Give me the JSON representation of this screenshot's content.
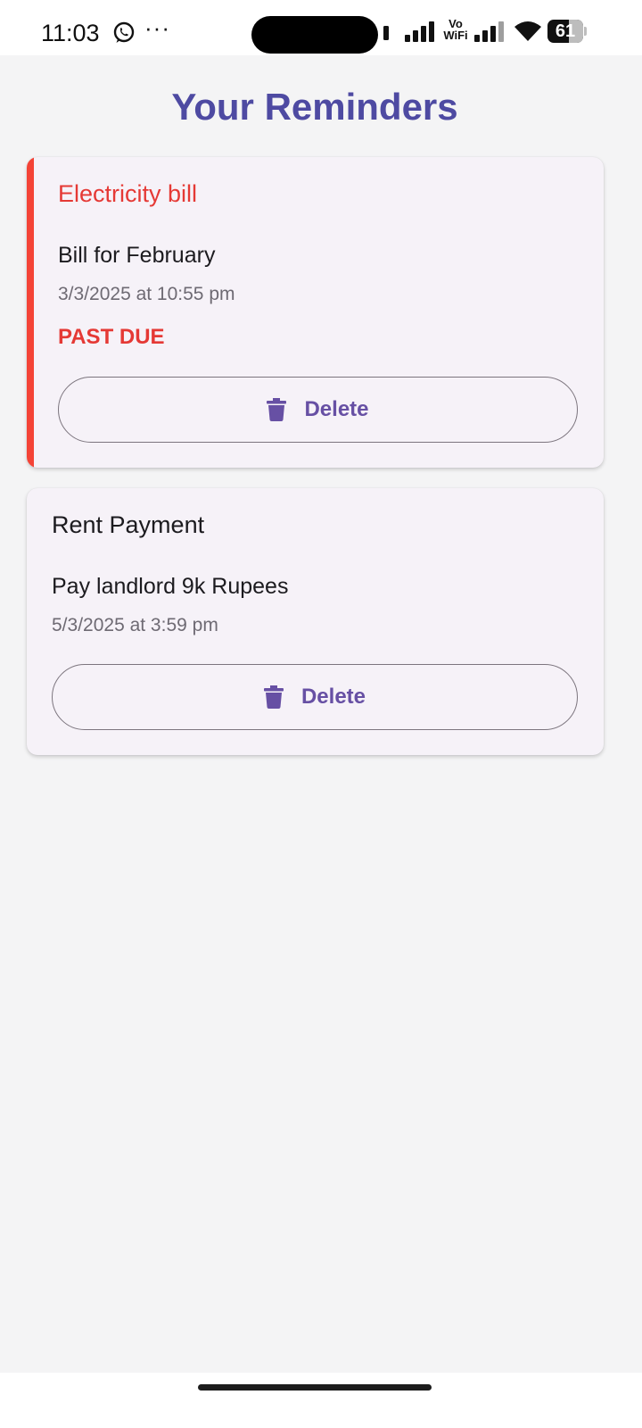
{
  "status_bar": {
    "time": "11:03",
    "vowifi_top": "Vo",
    "vowifi_bottom": "WiFi",
    "battery": "61",
    "battery_level_percent": 61,
    "more": "···"
  },
  "page": {
    "title": "Your Reminders"
  },
  "reminders": [
    {
      "title": "Electricity bill",
      "description": "Bill for February",
      "datetime": "3/3/2025 at 10:55 pm",
      "status": "PAST DUE",
      "delete_label": "Delete"
    },
    {
      "title": "Rent Payment",
      "description": "Pay landlord 9k Rupees",
      "datetime": "5/3/2025 at 3:59 pm",
      "delete_label": "Delete"
    }
  ],
  "colors": {
    "title": "#4e4aa2",
    "overdue_accent": "#f44336",
    "overdue_text": "#e53935",
    "button_text": "#6750a4",
    "card_background": "#f6f2f8",
    "page_background": "#f4f4f5"
  },
  "icons": {
    "status": [
      "whatsapp-icon",
      "vibrate-icon",
      "signal-icon",
      "wifi-icon",
      "battery-icon"
    ],
    "delete": "trash-icon"
  }
}
